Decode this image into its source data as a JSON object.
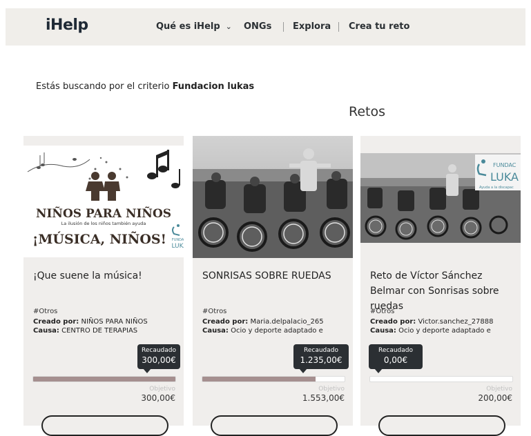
{
  "header": {
    "logo": "iHelp",
    "nav": [
      {
        "label": "Qué es iHelp",
        "has_dropdown": true,
        "dropdown_icon": "chevron-down-icon"
      },
      {
        "label": "ONGs"
      },
      {
        "label": "Explora"
      },
      {
        "label": "Crea tu reto"
      }
    ]
  },
  "search": {
    "prefix": "Estás buscando por el criterio ",
    "criterion": "Fundacion lukas"
  },
  "section_title": "Retos",
  "cards": [
    {
      "image": {
        "headline": "NIÑOS PARA NIÑOS",
        "subline": "La ilusión de los niños también ayuda",
        "tagline": "¡MÚSICA, NIÑOS!",
        "badge": "FUNDACI LUKA"
      },
      "title": "¡Que suene la música!",
      "tag": "#Otros",
      "created_label": "Creado por:",
      "created_by": "NIÑOS PARA NIÑOS",
      "cause_label": "Causa:",
      "cause": "CENTRO DE TERAPIAS",
      "raised_label": "Recaudado",
      "raised": "300,00€",
      "progress": 1.0,
      "goal_label": "Objetivo",
      "goal": "300,00€"
    },
    {
      "image": {
        "badge": ""
      },
      "title": "SONRISAS SOBRE RUEDAS",
      "tag": "#Otros",
      "created_label": "Creado por:",
      "created_by": "Maria.delpalacio_265",
      "cause_label": "Causa:",
      "cause": "Ocio y deporte adaptado e",
      "raised_label": "Recaudado",
      "raised": "1.235,00€",
      "progress": 0.7952,
      "goal_label": "Objetivo",
      "goal": "1.553,00€"
    },
    {
      "image": {
        "badge": "FUNDAC LUKA",
        "badge_sub": "Ayuda a la discapac"
      },
      "title": "Reto de Víctor Sánchez Belmar con Sonrisas sobre ruedas",
      "tag": "#Otros",
      "created_label": "Creado por:",
      "created_by": "Victor.sanchez_27888",
      "cause_label": "Causa:",
      "cause": "Ocio y deporte adaptado e",
      "raised_label": "Recaudado",
      "raised": "0,00€",
      "progress": 0.0,
      "goal_label": "Objetivo",
      "goal": "200,00€"
    }
  ],
  "colors": {
    "topbar": "#f0eeea",
    "card_bg": "#f0eeec",
    "progress_fill": "#a58f8f",
    "tooltip_bg": "#2b2f33",
    "text_dark": "#222222"
  }
}
